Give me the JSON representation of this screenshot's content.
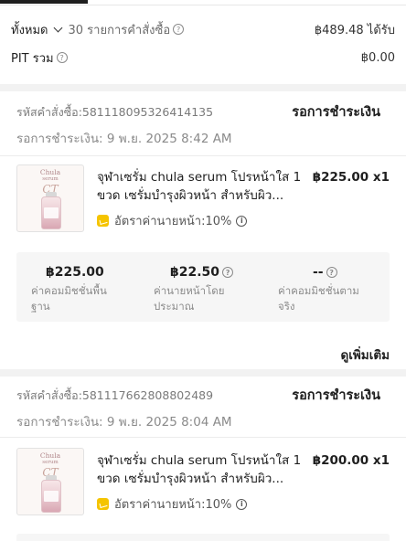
{
  "summary": {
    "filter_label": "ทั้งหมด",
    "orders_count": "30 รายการคำสั่งซื้อ",
    "earned_amount": "฿489.48 ได้รับ",
    "pit_label": "PIT รวม",
    "pit_value": "฿0.00"
  },
  "orders": [
    {
      "order_id": "รหัสคำสั่งซื้อ:581118095326414135",
      "status": "รอการชำระเงิน",
      "payment_time": "รอการชำระเงิน: 9 พ.ย. 2025 8:42 AM",
      "product": {
        "title": "จุฬาเซรั่ม chula serum โปรหน้าใส 1 ขวด เซรั่มบำรุงผิวหน้า สำหรับผิว...",
        "price_qty": "฿225.00 x1",
        "commission_rate": "อัตราค่านายหน้า:10%",
        "thumb_brand": "Chula",
        "thumb_brand2": "serum",
        "thumb_mark": "CT"
      },
      "commission": {
        "base_value": "฿225.00",
        "base_label": "ค่าคอมมิชชั่นพื้นฐาน",
        "est_value": "฿22.50",
        "est_label": "ค่านายหน้าโดยประมาณ",
        "actual_value": "--",
        "actual_label": "ค่าคอมมิชชั่นตามจริง"
      },
      "see_more": "ดูเพิ่มเติม"
    },
    {
      "order_id": "รหัสคำสั่งซื้อ:581117662808802489",
      "status": "รอการชำระเงิน",
      "payment_time": "รอการชำระเงิน: 9 พ.ย. 2025 8:04 AM",
      "product": {
        "title": "จุฬาเซรั่ม chula serum โปรหน้าใส 1 ขวด เซรั่มบำรุงผิวหน้า สำหรับผิว...",
        "price_qty": "฿200.00 x1",
        "commission_rate": "อัตราค่านายหน้า:10%",
        "thumb_brand": "Chula",
        "thumb_brand2": "serum",
        "thumb_mark": "CT"
      }
    }
  ]
}
